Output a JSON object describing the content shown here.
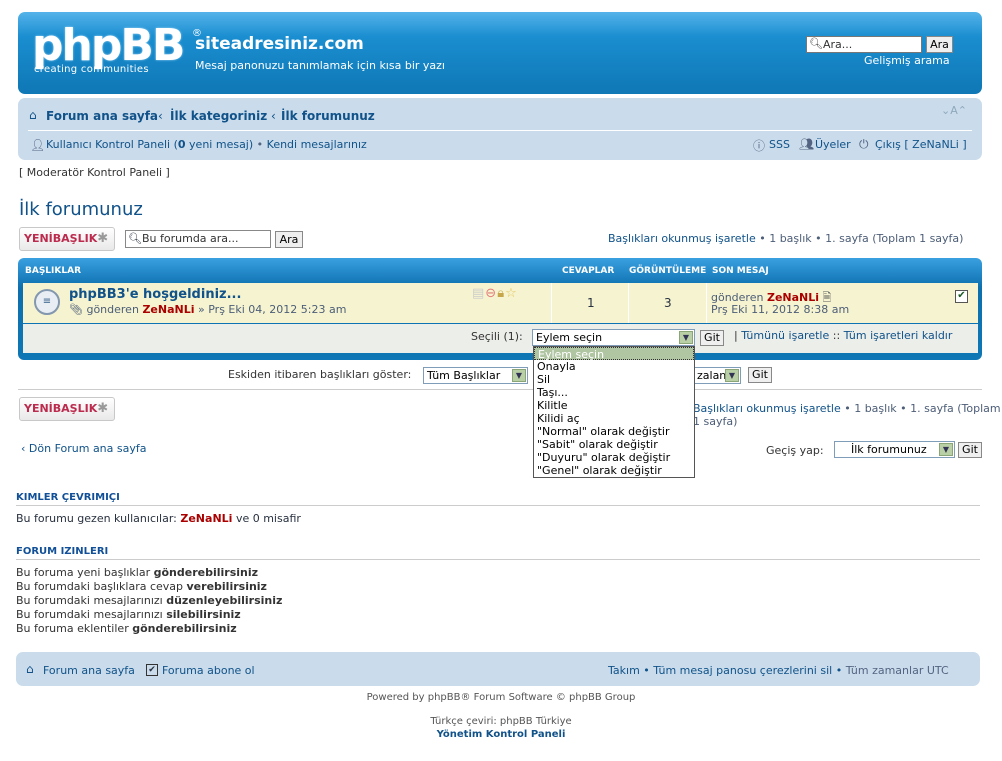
{
  "header": {
    "logo_text": "phpBB",
    "logo_reg": "®",
    "logo_sub": "creating communities",
    "site_title": "siteadresiniz.com",
    "site_desc": "Mesaj panonuzu tanımlamak için kısa bir yazı",
    "search_placeholder": "Ara...",
    "search_button": "Ara",
    "advanced_search": "Gelişmiş arama"
  },
  "navbar": {
    "crumbs": [
      "Forum ana sayfa",
      "İlk kategoriniz",
      "İlk forumunuz"
    ],
    "crumb_sep": "‹",
    "font_ctrl": "⌄A⌃",
    "ucp_label": "Kullanıcı Kontrol Paneli",
    "ucp_count": "0",
    "ucp_suffix": "yeni mesaj",
    "own_posts": "Kendi mesajlarınız",
    "faq": "SSS",
    "members": "Üyeler",
    "logout": "Çıkış [ ZeNaNLi ]"
  },
  "mcp_link": "[ Moderatör Kontrol Paneli ]",
  "forum_title": "İlk forumunuz",
  "new_topic": {
    "text_a": "YENİ",
    "text_b": "BAŞLIK",
    "star": "✱"
  },
  "forum_search": {
    "placeholder": "Bu forumda ara...",
    "button": "Ara"
  },
  "pagination": {
    "mark_read": "Başlıkları okunmuş işaretle",
    "topic_count": "1 başlık",
    "page": "1. sayfa",
    "total": "(Toplam 1 sayfa)"
  },
  "table": {
    "headers": {
      "topics": "BAŞLIKLAR",
      "replies": "CEVAPLAR",
      "views": "GÖRÜNTÜLEME",
      "last": "SON MESAJ"
    },
    "row": {
      "title": "phpBB3'e hoşgeldiniz...",
      "by": "gönderen",
      "author": "ZeNaNLi",
      "date": "» Prş Eki 04, 2012 5:23 am",
      "replies": "1",
      "views": "3",
      "last_by": "gönderen",
      "last_author": "ZeNaNLi",
      "last_date": "Prş Eki 11, 2012 8:38 am"
    },
    "selected_label": "Seçili (1):",
    "action_value": "Eylem seçin",
    "go": "Git",
    "mark_all": "Tümünü işaretle",
    "unmark_all": "Tüm işaretleri kaldır"
  },
  "action_options": [
    "Eylem seçin",
    "Onayla",
    "Sil",
    "Taşı...",
    "Kilitle",
    "Kilidi aç",
    "\"Normal\" olarak değiştir",
    "\"Sabit\" olarak değiştir",
    "\"Duyuru\" olarak değiştir",
    "\"Genel\" olarak değiştir"
  ],
  "display_filter": {
    "label": "Eskiden itibaren başlıkları göster:",
    "value": "Tüm Başlıklar",
    "order_value": "zalan",
    "go": "Git"
  },
  "back_link": "Dön Forum ana sayfa",
  "jump": {
    "label": "Geçiş yap:",
    "value": "İlk forumunuz",
    "go": "Git"
  },
  "online": {
    "heading": "KIMLER ÇEVRIMIÇI",
    "prefix": "Bu forumu gezen kullanıcılar:",
    "user": "ZeNaNLi",
    "suffix": "ve 0 misafir"
  },
  "permissions": {
    "heading": "FORUM IZINLERI",
    "items": [
      {
        "text": "Bu foruma yeni başlıklar",
        "strong": "gönderebilirsiniz"
      },
      {
        "text": "Bu forumdaki başlıklara cevap",
        "strong": "verebilirsiniz"
      },
      {
        "text": "Bu forumdaki mesajlarınızı",
        "strong": "düzenleyebilirsiniz"
      },
      {
        "text": "Bu forumdaki mesajlarınızı",
        "strong": "silebilirsiniz"
      },
      {
        "text": "Bu foruma eklentiler",
        "strong": "gönderebilirsiniz"
      }
    ]
  },
  "footer": {
    "home": "Forum ana sayfa",
    "subscribe": "Foruma abone ol",
    "team": "Takım",
    "cookies": "Tüm mesaj panosu çerezlerini sil",
    "timezone": "Tüm zamanlar UTC",
    "powered": "Powered by phpBB® Forum Software © phpBB Group",
    "translation": "Türkçe çeviri: phpBB Türkiye",
    "acp": "Yönetim Kontrol Paneli"
  },
  "colors": {
    "header_blue": "#1a8ed0",
    "nav_bg": "#cadceb",
    "row_bg": "#f6f4d0",
    "author_red": "#aa0000",
    "link": "#105289"
  }
}
